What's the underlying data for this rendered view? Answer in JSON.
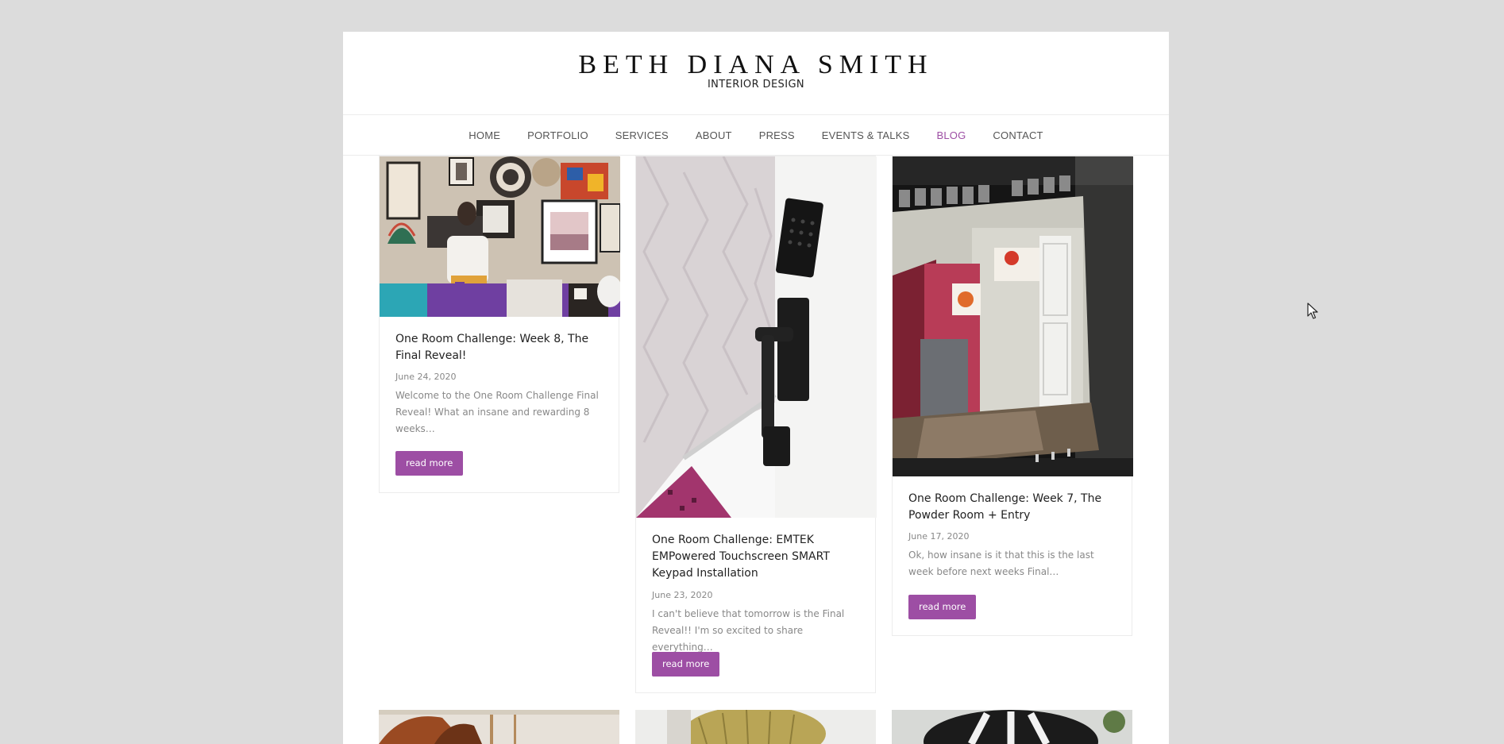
{
  "brand": {
    "name": "BETH DIANA SMITH",
    "tagline": "INTERIOR DESIGN"
  },
  "nav": {
    "items": [
      {
        "label": "HOME"
      },
      {
        "label": "PORTFOLIO"
      },
      {
        "label": "SERVICES"
      },
      {
        "label": "ABOUT"
      },
      {
        "label": "PRESS"
      },
      {
        "label": "EVENTS & TALKS"
      },
      {
        "label": "BLOG",
        "active": true
      },
      {
        "label": "CONTACT"
      }
    ]
  },
  "posts": [
    {
      "title": "One Room Challenge: Week 8, The Final Reveal!",
      "date": "June 24, 2020",
      "excerpt": "Welcome to the One Room Challenge Final Reveal! What an insane and rewarding 8 weeks…",
      "button": "read more"
    },
    {
      "title": "One Room Challenge: EMTEK EMPowered Touchscreen SMART Keypad Installation",
      "date": "June 23, 2020",
      "excerpt": "I can't believe that tomorrow is the Final Reveal!! I'm so excited to share everything…",
      "button": "read more"
    },
    {
      "title": "One Room Challenge: Week 7, The Powder Room + Entry",
      "date": "June 17, 2020",
      "excerpt": "Ok, how insane is it that this is the last week before next weeks Final…",
      "button": "read more"
    }
  ],
  "colors": {
    "accent": "#9d4ea4",
    "background": "#dcdcdc"
  }
}
